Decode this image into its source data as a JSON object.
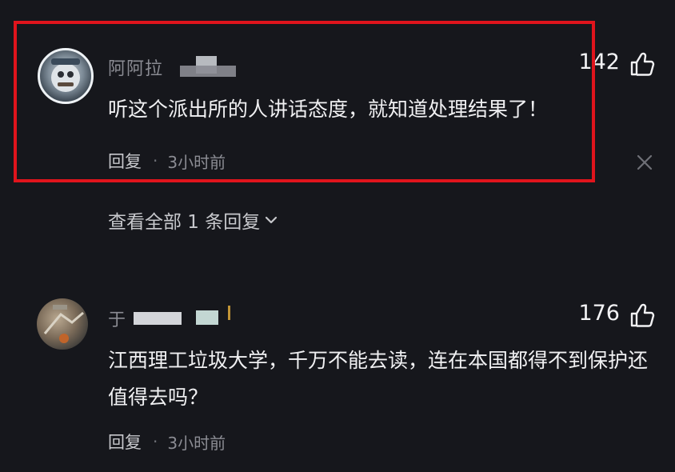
{
  "comments": [
    {
      "username": "阿阿拉 ",
      "likes": "142",
      "text": "听这个派出所的人讲话态度，就知道处理结果了！",
      "reply_label": "回复",
      "separator": "·",
      "time": "3小时前"
    },
    {
      "username": "于",
      "likes": "176",
      "text": "江西理工垃圾大学，千万不能去读，连在本国都得不到保护还值得去吗？",
      "reply_label": "回复",
      "separator": "·",
      "time": "3小时前"
    }
  ],
  "view_replies_label": "查看全部 1 条回复",
  "colors": {
    "background": "#16171c",
    "highlight": "#e0141c",
    "muted_text": "#8b8c93"
  },
  "icons": {
    "like": "thumbs-up-icon",
    "close": "close-icon",
    "expand": "chevron-down-icon"
  }
}
